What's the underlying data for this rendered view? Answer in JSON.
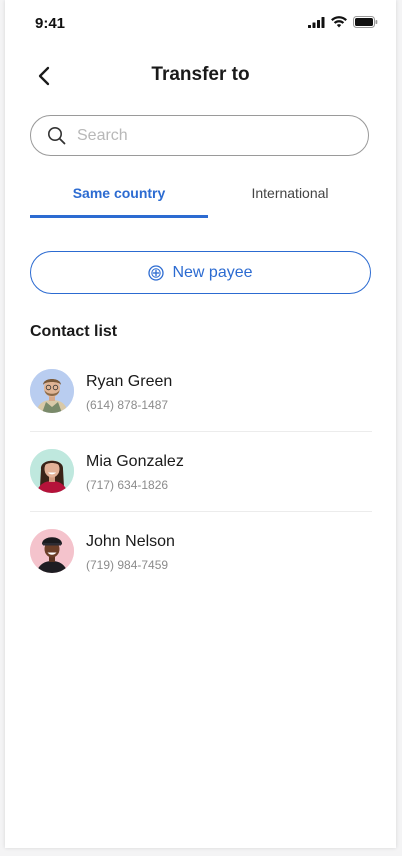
{
  "status_bar": {
    "time": "9:41"
  },
  "header": {
    "title": "Transfer to"
  },
  "search": {
    "placeholder": "Search",
    "value": ""
  },
  "tabs": [
    {
      "label": "Same country",
      "active": true
    },
    {
      "label": "International",
      "active": false
    }
  ],
  "new_payee": {
    "label": "New payee",
    "icon": "plus-circle-icon"
  },
  "contacts_section": {
    "title": "Contact list"
  },
  "contacts": [
    {
      "name": "Ryan Green",
      "phone": "(614) 878-1487",
      "avatar_bg": "#b9cdf0"
    },
    {
      "name": "Mia Gonzalez",
      "phone": "(717) 634-1826",
      "avatar_bg": "#bfe8de"
    },
    {
      "name": "John Nelson",
      "phone": "(719) 984-7459",
      "avatar_bg": "#f4c3cc"
    }
  ],
  "colors": {
    "accent": "#2c6bd1",
    "divider": "#ececec",
    "muted_text": "#8b8b8b"
  }
}
